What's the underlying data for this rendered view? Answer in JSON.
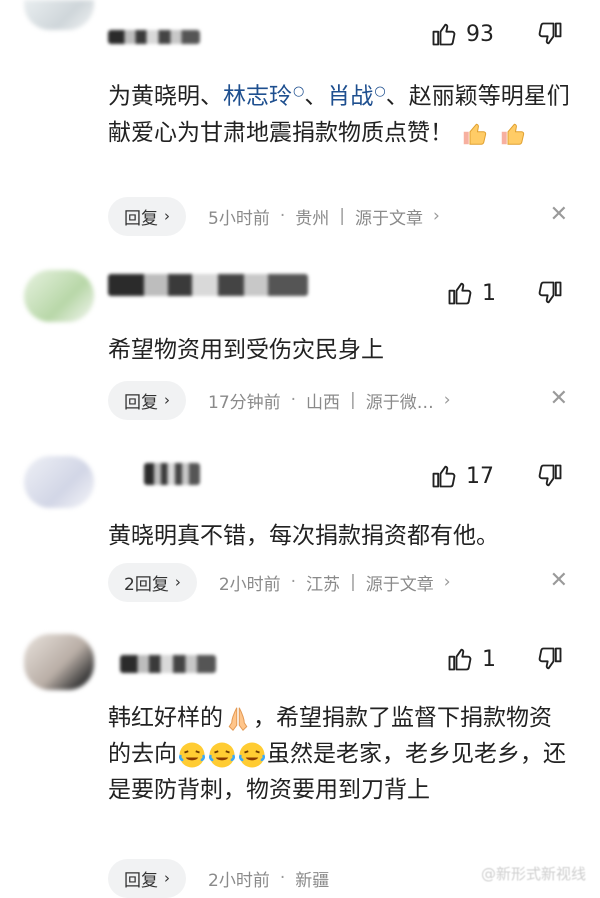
{
  "comments": [
    {
      "likes": "93",
      "text_parts": [
        "为黄晓明",
        "、",
        "林志玲",
        "、",
        "肖战",
        "、赵丽颖等明星们献爱心为甘肃地震捐款物质点赞！"
      ],
      "reply_label": "回复",
      "time": "5小时前",
      "location": "贵州",
      "source": "源于文章"
    },
    {
      "likes": "1",
      "text": "希望物资用到受伤灾民身上",
      "reply_label": "回复",
      "time": "17分钟前",
      "location": "山西",
      "source": "源于微…"
    },
    {
      "likes": "17",
      "text": "黄晓明真不错，每次捐款捐资都有他。",
      "reply_label": "2回复",
      "time": "2小时前",
      "location": "江苏",
      "source": "源于文章"
    },
    {
      "likes": "1",
      "text_a": "韩红好样的",
      "text_b": "，希望捐款了监督下捐款物资的去向",
      "text_c": "虽然是老家，老乡见老乡，还是要防背刺，物资要用到刀背上",
      "reply_label": "回复",
      "time": "2小时前",
      "location": "新疆"
    }
  ],
  "watermark": "@新形式新视线",
  "icons": {
    "like": "thumb-up-icon",
    "dislike": "thumb-down-icon",
    "close": "close-icon"
  }
}
